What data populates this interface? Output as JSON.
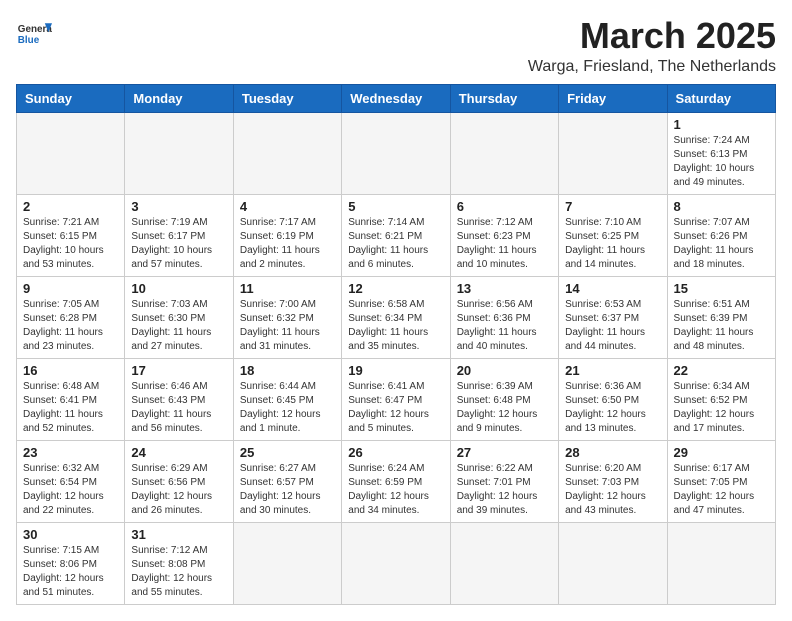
{
  "header": {
    "logo_general": "General",
    "logo_blue": "Blue",
    "month_title": "March 2025",
    "subtitle": "Warga, Friesland, The Netherlands"
  },
  "weekdays": [
    "Sunday",
    "Monday",
    "Tuesday",
    "Wednesday",
    "Thursday",
    "Friday",
    "Saturday"
  ],
  "weeks": [
    [
      {
        "day": "",
        "info": ""
      },
      {
        "day": "",
        "info": ""
      },
      {
        "day": "",
        "info": ""
      },
      {
        "day": "",
        "info": ""
      },
      {
        "day": "",
        "info": ""
      },
      {
        "day": "",
        "info": ""
      },
      {
        "day": "1",
        "info": "Sunrise: 7:24 AM\nSunset: 6:13 PM\nDaylight: 10 hours\nand 49 minutes."
      }
    ],
    [
      {
        "day": "2",
        "info": "Sunrise: 7:21 AM\nSunset: 6:15 PM\nDaylight: 10 hours\nand 53 minutes."
      },
      {
        "day": "3",
        "info": "Sunrise: 7:19 AM\nSunset: 6:17 PM\nDaylight: 10 hours\nand 57 minutes."
      },
      {
        "day": "4",
        "info": "Sunrise: 7:17 AM\nSunset: 6:19 PM\nDaylight: 11 hours\nand 2 minutes."
      },
      {
        "day": "5",
        "info": "Sunrise: 7:14 AM\nSunset: 6:21 PM\nDaylight: 11 hours\nand 6 minutes."
      },
      {
        "day": "6",
        "info": "Sunrise: 7:12 AM\nSunset: 6:23 PM\nDaylight: 11 hours\nand 10 minutes."
      },
      {
        "day": "7",
        "info": "Sunrise: 7:10 AM\nSunset: 6:25 PM\nDaylight: 11 hours\nand 14 minutes."
      },
      {
        "day": "8",
        "info": "Sunrise: 7:07 AM\nSunset: 6:26 PM\nDaylight: 11 hours\nand 18 minutes."
      }
    ],
    [
      {
        "day": "9",
        "info": "Sunrise: 7:05 AM\nSunset: 6:28 PM\nDaylight: 11 hours\nand 23 minutes."
      },
      {
        "day": "10",
        "info": "Sunrise: 7:03 AM\nSunset: 6:30 PM\nDaylight: 11 hours\nand 27 minutes."
      },
      {
        "day": "11",
        "info": "Sunrise: 7:00 AM\nSunset: 6:32 PM\nDaylight: 11 hours\nand 31 minutes."
      },
      {
        "day": "12",
        "info": "Sunrise: 6:58 AM\nSunset: 6:34 PM\nDaylight: 11 hours\nand 35 minutes."
      },
      {
        "day": "13",
        "info": "Sunrise: 6:56 AM\nSunset: 6:36 PM\nDaylight: 11 hours\nand 40 minutes."
      },
      {
        "day": "14",
        "info": "Sunrise: 6:53 AM\nSunset: 6:37 PM\nDaylight: 11 hours\nand 44 minutes."
      },
      {
        "day": "15",
        "info": "Sunrise: 6:51 AM\nSunset: 6:39 PM\nDaylight: 11 hours\nand 48 minutes."
      }
    ],
    [
      {
        "day": "16",
        "info": "Sunrise: 6:48 AM\nSunset: 6:41 PM\nDaylight: 11 hours\nand 52 minutes."
      },
      {
        "day": "17",
        "info": "Sunrise: 6:46 AM\nSunset: 6:43 PM\nDaylight: 11 hours\nand 56 minutes."
      },
      {
        "day": "18",
        "info": "Sunrise: 6:44 AM\nSunset: 6:45 PM\nDaylight: 12 hours\nand 1 minute."
      },
      {
        "day": "19",
        "info": "Sunrise: 6:41 AM\nSunset: 6:47 PM\nDaylight: 12 hours\nand 5 minutes."
      },
      {
        "day": "20",
        "info": "Sunrise: 6:39 AM\nSunset: 6:48 PM\nDaylight: 12 hours\nand 9 minutes."
      },
      {
        "day": "21",
        "info": "Sunrise: 6:36 AM\nSunset: 6:50 PM\nDaylight: 12 hours\nand 13 minutes."
      },
      {
        "day": "22",
        "info": "Sunrise: 6:34 AM\nSunset: 6:52 PM\nDaylight: 12 hours\nand 17 minutes."
      }
    ],
    [
      {
        "day": "23",
        "info": "Sunrise: 6:32 AM\nSunset: 6:54 PM\nDaylight: 12 hours\nand 22 minutes."
      },
      {
        "day": "24",
        "info": "Sunrise: 6:29 AM\nSunset: 6:56 PM\nDaylight: 12 hours\nand 26 minutes."
      },
      {
        "day": "25",
        "info": "Sunrise: 6:27 AM\nSunset: 6:57 PM\nDaylight: 12 hours\nand 30 minutes."
      },
      {
        "day": "26",
        "info": "Sunrise: 6:24 AM\nSunset: 6:59 PM\nDaylight: 12 hours\nand 34 minutes."
      },
      {
        "day": "27",
        "info": "Sunrise: 6:22 AM\nSunset: 7:01 PM\nDaylight: 12 hours\nand 39 minutes."
      },
      {
        "day": "28",
        "info": "Sunrise: 6:20 AM\nSunset: 7:03 PM\nDaylight: 12 hours\nand 43 minutes."
      },
      {
        "day": "29",
        "info": "Sunrise: 6:17 AM\nSunset: 7:05 PM\nDaylight: 12 hours\nand 47 minutes."
      }
    ],
    [
      {
        "day": "30",
        "info": "Sunrise: 7:15 AM\nSunset: 8:06 PM\nDaylight: 12 hours\nand 51 minutes."
      },
      {
        "day": "31",
        "info": "Sunrise: 7:12 AM\nSunset: 8:08 PM\nDaylight: 12 hours\nand 55 minutes."
      },
      {
        "day": "",
        "info": ""
      },
      {
        "day": "",
        "info": ""
      },
      {
        "day": "",
        "info": ""
      },
      {
        "day": "",
        "info": ""
      },
      {
        "day": "",
        "info": ""
      }
    ]
  ]
}
